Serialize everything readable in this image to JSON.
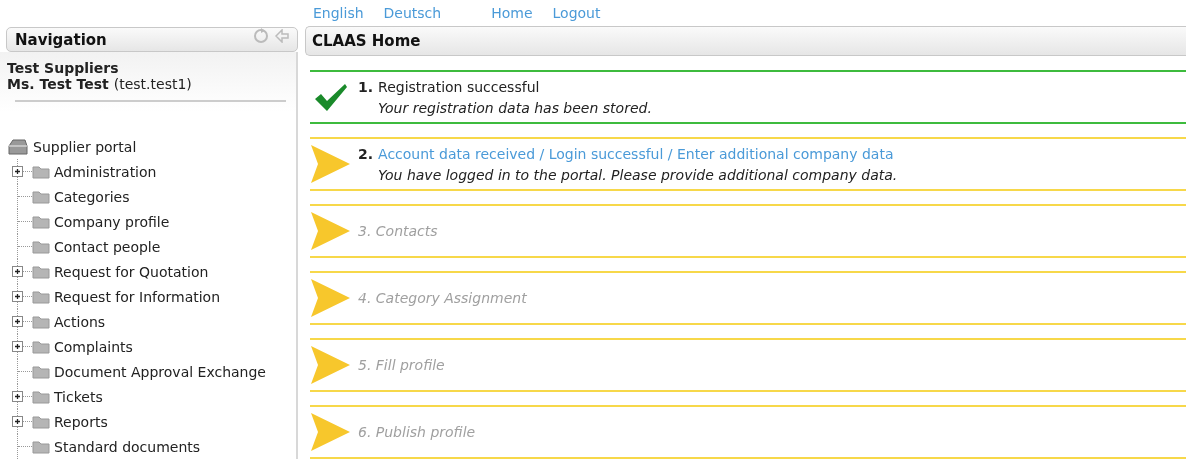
{
  "top_links": [
    "English",
    "Deutsch",
    "Home",
    "Logout"
  ],
  "navigation": {
    "title": "Navigation",
    "company": "Test Suppliers",
    "user_name": "Ms. Test Test",
    "user_login": "(test.test1)",
    "tree": {
      "label": "Supplier portal",
      "children": [
        {
          "label": "Administration",
          "expandable": true
        },
        {
          "label": "Categories",
          "expandable": false
        },
        {
          "label": "Company profile",
          "expandable": false
        },
        {
          "label": "Contact people",
          "expandable": false
        },
        {
          "label": "Request for Quotation",
          "expandable": true
        },
        {
          "label": "Request for Information",
          "expandable": true
        },
        {
          "label": "Actions",
          "expandable": true
        },
        {
          "label": "Complaints",
          "expandable": true
        },
        {
          "label": "Document Approval Exchange",
          "expandable": false
        },
        {
          "label": "Tickets",
          "expandable": true
        },
        {
          "label": "Reports",
          "expandable": true
        },
        {
          "label": "Standard documents",
          "expandable": false
        }
      ]
    }
  },
  "main": {
    "title": "CLAAS Home",
    "steps": [
      {
        "kind": "done",
        "number": "1.",
        "title": "Registration successful",
        "description": "Your registration data has been stored."
      },
      {
        "kind": "current",
        "number": "2.",
        "title": "Account data received / Login successful / Enter additional company data",
        "description": "You have logged in to the portal. Please provide additional company data."
      },
      {
        "kind": "pending",
        "title": "3. Contacts"
      },
      {
        "kind": "pending",
        "title": "4. Category Assignment"
      },
      {
        "kind": "pending",
        "title": "5. Fill profile"
      },
      {
        "kind": "pending",
        "title": "6. Publish profile"
      }
    ]
  }
}
